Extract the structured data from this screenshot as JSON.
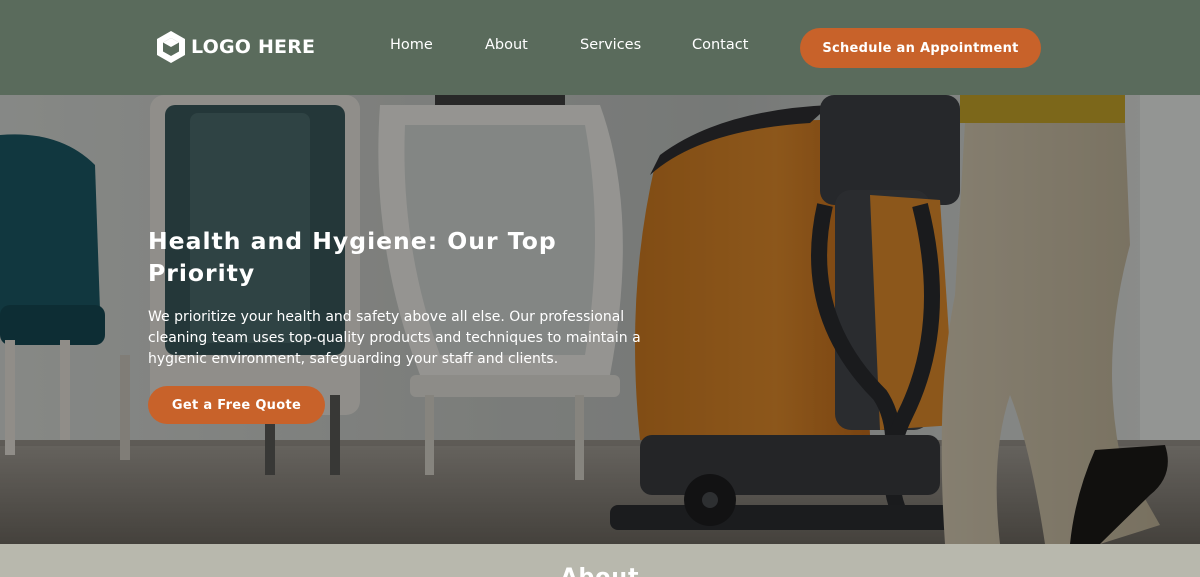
{
  "header": {
    "logo_text": "LOGO HERE",
    "nav": [
      "Home",
      "About",
      "Services",
      "Contact"
    ],
    "cta_label": "Schedule an Appointment"
  },
  "hero": {
    "title": "Health and Hygiene: Our Top Priority",
    "description": "We prioritize your health and safety above all else. Our professional cleaning team uses top-quality products and techniques to maintain a hygienic environment, safeguarding your staff and clients.",
    "cta_label": "Get a Free Quote"
  },
  "about": {
    "heading": "About"
  },
  "colors": {
    "header_bg": "#5a6b5c",
    "accent": "#c8622a",
    "text_light": "#ffffff",
    "about_bg": "#b8b8ad"
  },
  "icons": [
    "hexagon-logo-icon"
  ]
}
